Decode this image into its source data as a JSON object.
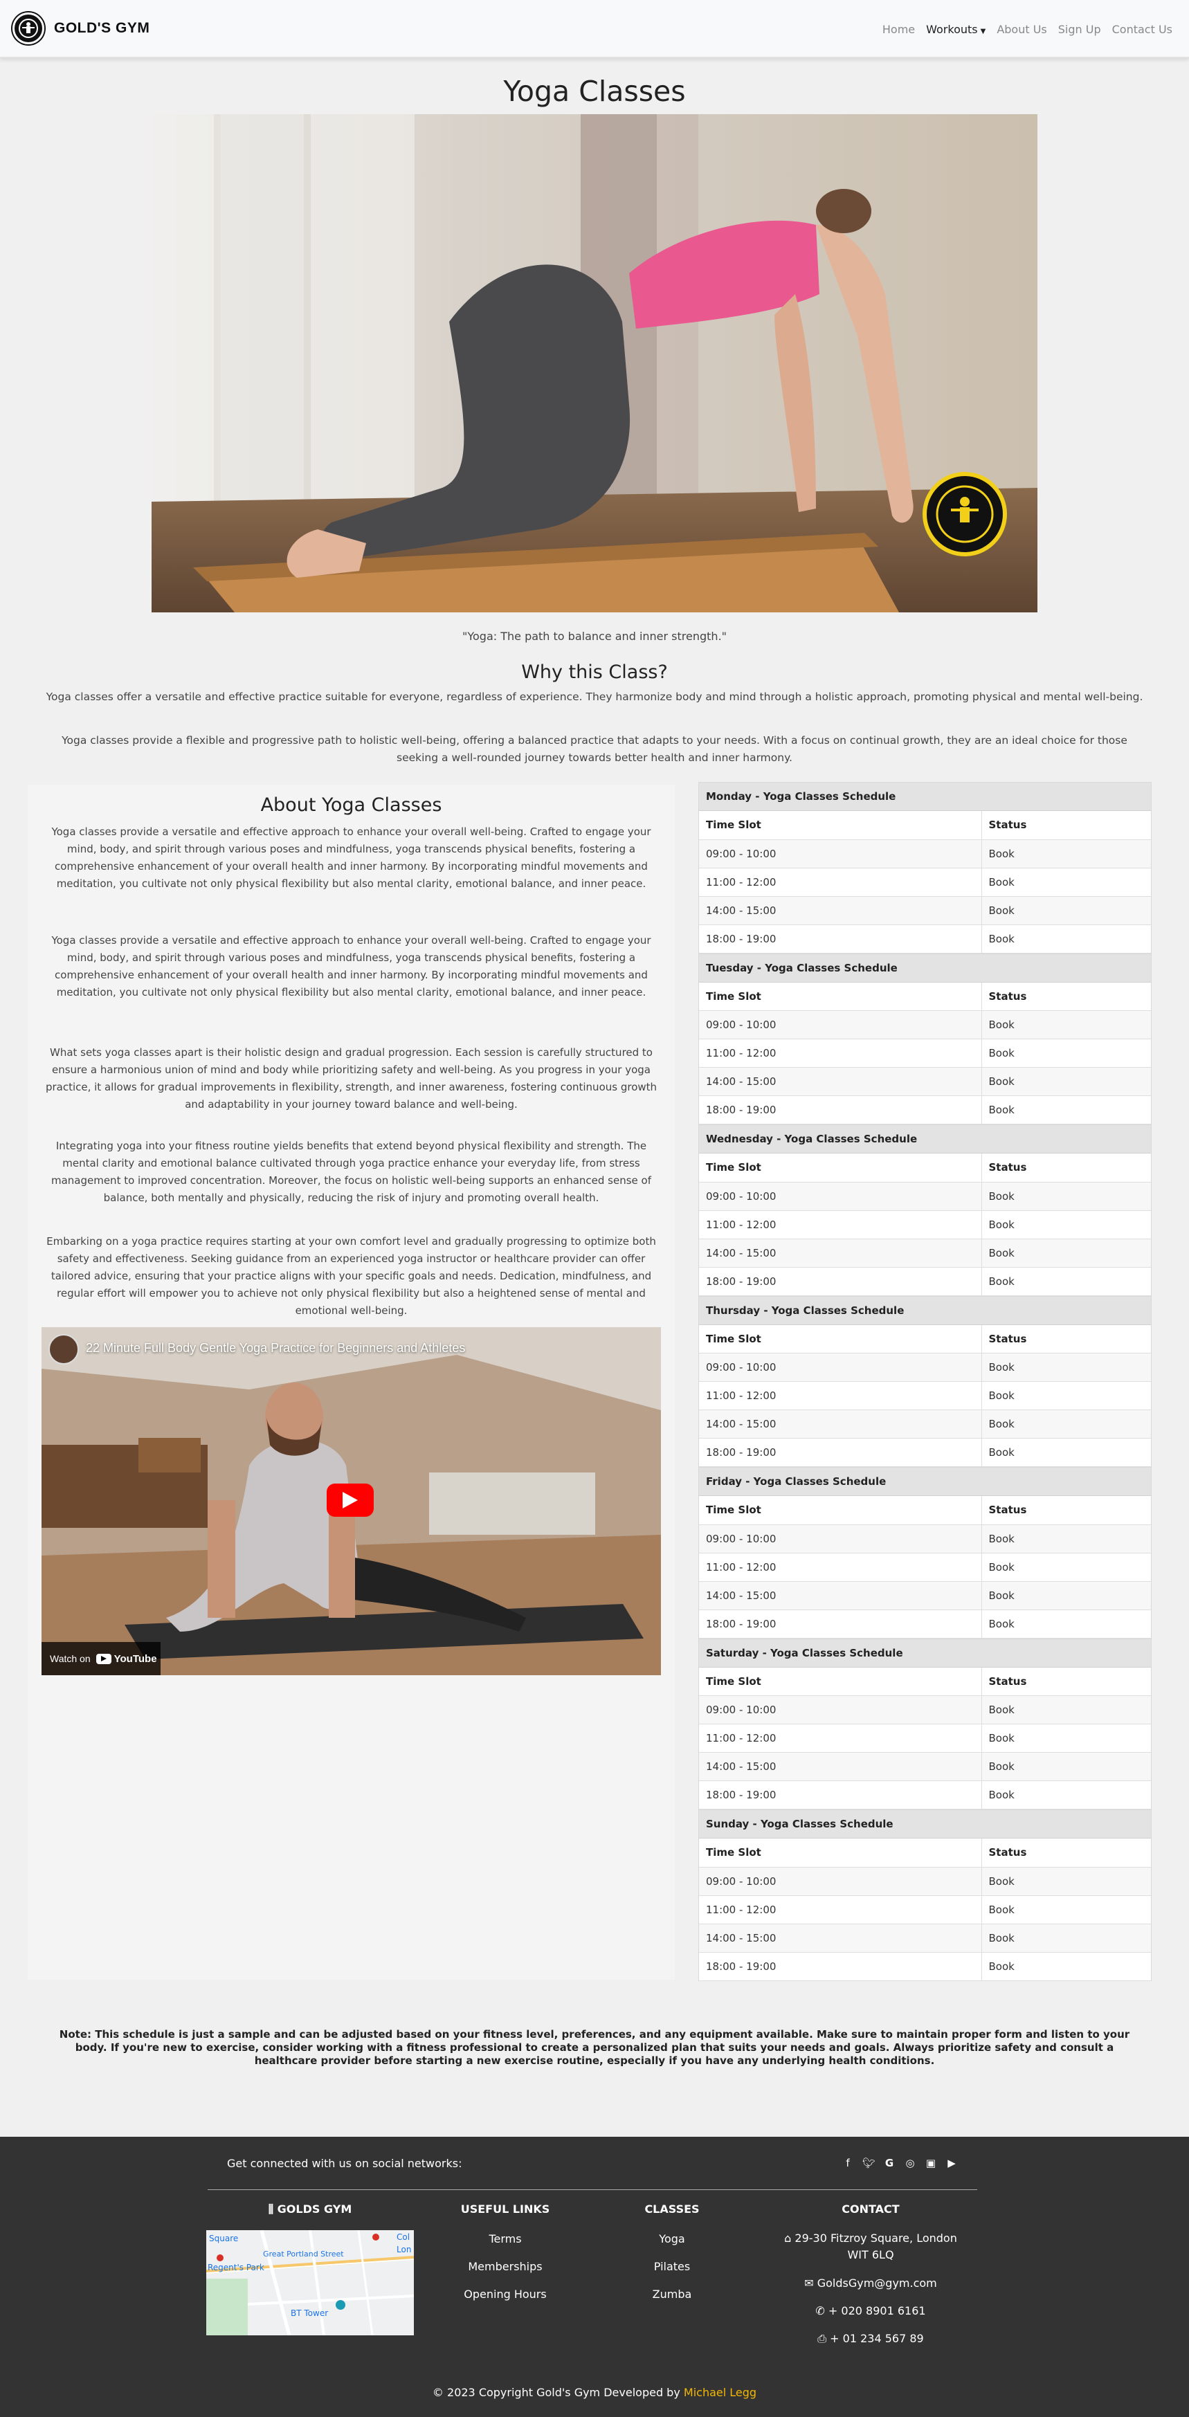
{
  "nav": {
    "brand": "GOLD'S GYM",
    "links": [
      "Home",
      "Workouts",
      "About Us",
      "Sign Up",
      "Contact Us"
    ]
  },
  "page": {
    "title": "Yoga Classes",
    "quote": "\"Yoga: The path to balance and inner strength.\"",
    "why_title": "Why this Class?",
    "why_paragraphs": [
      "Yoga classes offer a versatile and effective practice suitable for everyone, regardless of experience. They harmonize body and mind through a holistic approach, promoting physical and mental well-being.",
      "Yoga classes provide a flexible and progressive path to holistic well-being, offering a balanced practice that adapts to your needs. With a focus on continual growth, they are an ideal choice for those seeking a well-rounded journey towards better health and inner harmony."
    ]
  },
  "about": {
    "title": "About Yoga Classes",
    "paragraphs": [
      "Yoga classes provide a versatile and effective approach to enhance your overall well-being. Crafted to engage your mind, body, and spirit through various poses and mindfulness, yoga transcends physical benefits, fostering a comprehensive enhancement of your overall health and inner harmony. By incorporating mindful movements and meditation, you cultivate not only physical flexibility but also mental clarity, emotional balance, and inner peace.",
      "Yoga classes provide a versatile and effective approach to enhance your overall well-being. Crafted to engage your mind, body, and spirit through various poses and mindfulness, yoga transcends physical benefits, fostering a comprehensive enhancement of your overall health and inner harmony. By incorporating mindful movements and meditation, you cultivate not only physical flexibility but also mental clarity, emotional balance, and inner peace.",
      "What sets yoga classes apart is their holistic design and gradual progression. Each session is carefully structured to ensure a harmonious union of mind and body while prioritizing safety and well-being. As you progress in your yoga practice, it allows for gradual improvements in flexibility, strength, and inner awareness, fostering continuous growth and adaptability in your journey toward balance and well-being.",
      "Integrating yoga into your fitness routine yields benefits that extend beyond physical flexibility and strength. The mental clarity and emotional balance cultivated through yoga practice enhance your everyday life, from stress management to improved concentration. Moreover, the focus on holistic well-being supports an enhanced sense of balance, both mentally and physically, reducing the risk of injury and promoting overall health.",
      "Embarking on a yoga practice requires starting at your own comfort level and gradually progressing to optimize both safety and effectiveness. Seeking guidance from an experienced yoga instructor or healthcare provider can offer tailored advice, ensuring that your practice aligns with your specific goals and needs. Dedication, mindfulness, and regular effort will empower you to achieve not only physical flexibility but also a heightened sense of mental and emotional well-being."
    ],
    "video": {
      "title": "22 Minute Full Body Gentle Yoga Practice for Beginners and Athletes",
      "watch_on": "Watch on",
      "youtube": "YouTube"
    }
  },
  "schedule": {
    "col_time": "Time Slot",
    "col_status": "Status",
    "days": [
      {
        "header": "Monday - Yoga Classes Schedule",
        "rows": [
          [
            "09:00 - 10:00",
            "Book"
          ],
          [
            "11:00 - 12:00",
            "Book"
          ],
          [
            "14:00 - 15:00",
            "Book"
          ],
          [
            "18:00 - 19:00",
            "Book"
          ]
        ]
      },
      {
        "header": "Tuesday - Yoga Classes Schedule",
        "rows": [
          [
            "09:00 - 10:00",
            "Book"
          ],
          [
            "11:00 - 12:00",
            "Book"
          ],
          [
            "14:00 - 15:00",
            "Book"
          ],
          [
            "18:00 - 19:00",
            "Book"
          ]
        ]
      },
      {
        "header": "Wednesday - Yoga Classes Schedule",
        "rows": [
          [
            "09:00 - 10:00",
            "Book"
          ],
          [
            "11:00 - 12:00",
            "Book"
          ],
          [
            "14:00 - 15:00",
            "Book"
          ],
          [
            "18:00 - 19:00",
            "Book"
          ]
        ]
      },
      {
        "header": "Thursday - Yoga Classes Schedule",
        "rows": [
          [
            "09:00 - 10:00",
            "Book"
          ],
          [
            "11:00 - 12:00",
            "Book"
          ],
          [
            "14:00 - 15:00",
            "Book"
          ],
          [
            "18:00 - 19:00",
            "Book"
          ]
        ]
      },
      {
        "header": "Friday - Yoga Classes Schedule",
        "rows": [
          [
            "09:00 - 10:00",
            "Book"
          ],
          [
            "11:00 - 12:00",
            "Book"
          ],
          [
            "14:00 - 15:00",
            "Book"
          ],
          [
            "18:00 - 19:00",
            "Book"
          ]
        ]
      },
      {
        "header": "Saturday - Yoga Classes Schedule",
        "rows": [
          [
            "09:00 - 10:00",
            "Book"
          ],
          [
            "11:00 - 12:00",
            "Book"
          ],
          [
            "14:00 - 15:00",
            "Book"
          ],
          [
            "18:00 - 19:00",
            "Book"
          ]
        ]
      },
      {
        "header": "Sunday - Yoga Classes Schedule",
        "rows": [
          [
            "09:00 - 10:00",
            "Book"
          ],
          [
            "11:00 - 12:00",
            "Book"
          ],
          [
            "14:00 - 15:00",
            "Book"
          ],
          [
            "18:00 - 19:00",
            "Book"
          ]
        ]
      }
    ]
  },
  "note": "Note: This schedule is just a sample and can be adjusted based on your fitness level, preferences, and any equipment available. Make sure to maintain proper form and listen to your body. If you're new to exercise, consider working with a fitness professional to create a personalized plan that suits your needs and goals. Always prioritize safety and consult a healthcare provider before starting a new exercise routine, especially if you have any underlying health conditions.",
  "footer": {
    "social_text": "Get connected with us on social networks:",
    "social_icons": [
      "facebook-icon",
      "twitter-icon",
      "google-icon",
      "instagram-icon",
      "linkedin-icon",
      "youtube-icon"
    ],
    "brand_title": "GOLDS GYM",
    "map_labels": [
      "Square",
      "Great Portland Street",
      "Regent's Park",
      "BT Tower",
      "Col",
      "Lon"
    ],
    "useful_title": "USEFUL LINKS",
    "useful_links": [
      "Terms",
      "Memberships",
      "Opening Hours"
    ],
    "classes_title": "CLASSES",
    "classes_links": [
      "Yoga",
      "Pilates",
      "Zumba"
    ],
    "contact_title": "CONTACT",
    "address": "29-30 Fitzroy Square, London WIT 6LQ",
    "email": "GoldsGym@gym.com",
    "phone": "+ 020 8901 6161",
    "fax": "+ 01 234 567 89",
    "copyright": "© 2023 Copyright Gold's Gym Developed by",
    "developer": "Michael Legg"
  },
  "colors": {
    "accent": "#f2b706",
    "footer_bg": "#333333",
    "youtube_red": "#ff0000"
  }
}
